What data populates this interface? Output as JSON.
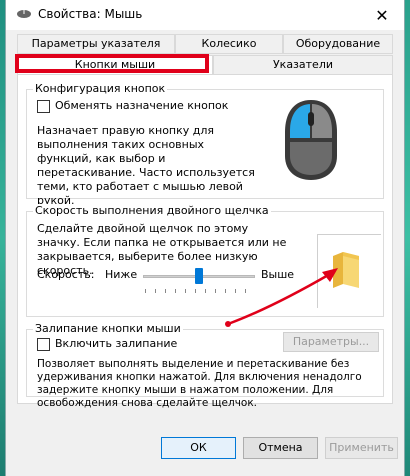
{
  "window": {
    "title": "Свойства: Мышь",
    "close_glyph": "✕"
  },
  "tabs_row1": [
    "Параметры указателя",
    "Колесико",
    "Оборудование"
  ],
  "tabs_row2": [
    "Кнопки мыши",
    "Указатели"
  ],
  "button_config": {
    "title": "Конфигурация кнопок",
    "checkbox_label": "Обменять назначение кнопок",
    "description": "Назначает правую кнопку для выполнения таких основных функций, как выбор и перетаскивание. Часто используется теми, кто работает с мышью левой рукой."
  },
  "double_click": {
    "title": "Скорость выполнения двойного щелчка",
    "description": "Сделайте двойной щелчок по этому значку. Если папка не открывается или не закрывается, выберите более низкую скорость.",
    "speed_label": "Скорость:",
    "low_label": "Ниже",
    "high_label": "Выше",
    "slider_value": 0.5
  },
  "click_lock": {
    "title": "Залипание кнопки мыши",
    "checkbox_label": "Включить залипание",
    "settings_button": "Параметры...",
    "description": "Позволяет выполнять выделение и перетаскивание без удерживания кнопки нажатой. Для включения ненадолго задержите кнопку мыши в нажатом положении. Для освобождения снова сделайте щелчок."
  },
  "footer": {
    "ok": "ОК",
    "cancel": "Отмена",
    "apply": "Применить"
  },
  "annotation_color": "#e0001a",
  "icons": [
    "mouse-icon",
    "folder-icon",
    "close-icon"
  ]
}
